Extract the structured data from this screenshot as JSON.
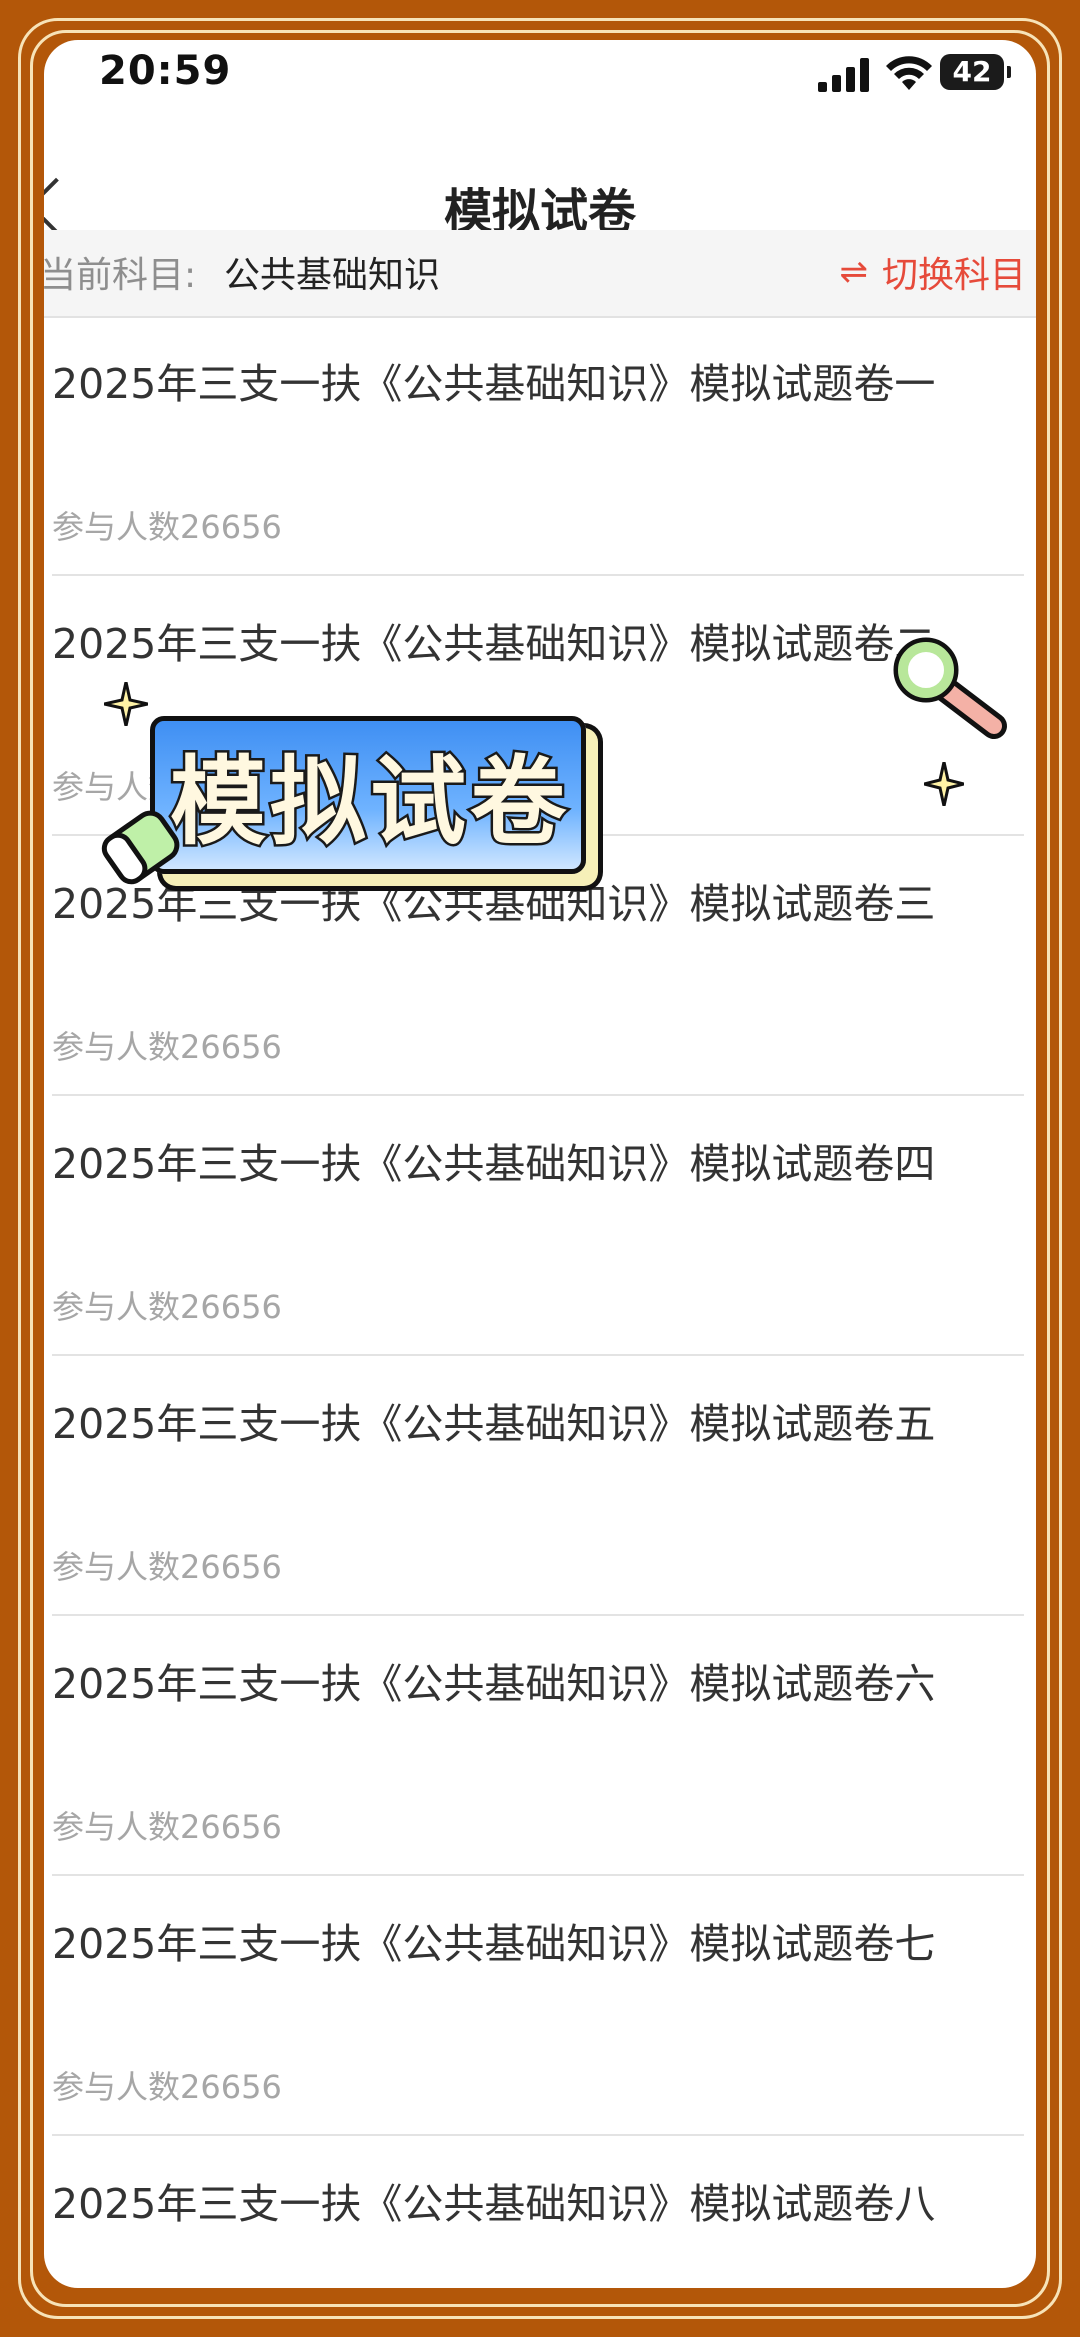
{
  "status_bar": {
    "time": "20:59",
    "battery": "42"
  },
  "nav": {
    "title": "模拟试卷"
  },
  "subject": {
    "label": "当前科目:",
    "value": "公共基础知识",
    "switch_label": "切换科目",
    "switch_icon": "⇌"
  },
  "overlay": {
    "badge_text": "模拟试卷"
  },
  "exams": [
    {
      "title": "2025年三支一扶《公共基础知识》模拟试题卷一",
      "count": "参与人数26656"
    },
    {
      "title": "2025年三支一扶《公共基础知识》模拟试题卷二",
      "count": "参与人数26656"
    },
    {
      "title": "2025年三支一扶《公共基础知识》模拟试题卷三",
      "count": "参与人数26656"
    },
    {
      "title": "2025年三支一扶《公共基础知识》模拟试题卷四",
      "count": "参与人数26656"
    },
    {
      "title": "2025年三支一扶《公共基础知识》模拟试题卷五",
      "count": "参与人数26656"
    },
    {
      "title": "2025年三支一扶《公共基础知识》模拟试题卷六",
      "count": "参与人数26656"
    },
    {
      "title": "2025年三支一扶《公共基础知识》模拟试题卷七",
      "count": "参与人数26656"
    },
    {
      "title": "2025年三支一扶《公共基础知识》模拟试题卷八",
      "count": ""
    }
  ],
  "colors": {
    "frame": "#b35709",
    "accent": "#e64a3a",
    "badge_blue": "#3f8ff3"
  }
}
